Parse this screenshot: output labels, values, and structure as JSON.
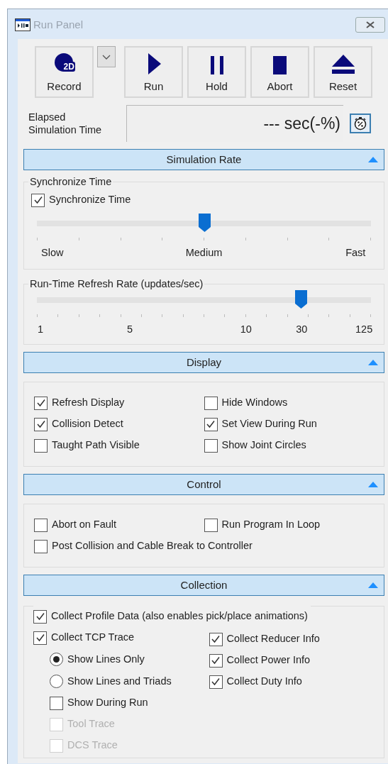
{
  "window": {
    "title": "Run Panel"
  },
  "toolbar": [
    {
      "kind": "record",
      "label": "Record",
      "badge": "2D"
    },
    {
      "kind": "dropdown"
    },
    {
      "kind": "run",
      "label": "Run"
    },
    {
      "kind": "hold",
      "label": "Hold"
    },
    {
      "kind": "abort",
      "label": "Abort"
    },
    {
      "kind": "reset",
      "label": "Reset"
    }
  ],
  "elapsed": {
    "label": "Elapsed Simulation Time",
    "value": "--- sec(-%)"
  },
  "sections": [
    {
      "kind": "rate",
      "title": "Simulation Rate",
      "expanded": true,
      "sync_group": {
        "title": "Synchronize Time",
        "checkbox": {
          "label": "Synchronize Time",
          "checked": true
        },
        "slider": {
          "level": 0.5,
          "labels": [
            "Slow",
            "Medium",
            "Fast"
          ]
        }
      },
      "refresh_group": {
        "title": "Run-Time Refresh Rate (updates/sec)",
        "slider": {
          "level": 0.79,
          "labels": [
            "1",
            "5",
            "10",
            "30",
            "125"
          ]
        }
      }
    },
    {
      "kind": "checks",
      "title": "Display",
      "expanded": true,
      "items": [
        {
          "label": "Refresh Display",
          "checked": true
        },
        {
          "label": "Hide Windows",
          "checked": false
        },
        {
          "label": "Collision Detect",
          "checked": true
        },
        {
          "label": "Set View During Run",
          "checked": true
        },
        {
          "label": "Taught Path Visible",
          "checked": false
        },
        {
          "label": "Show Joint Circles",
          "checked": false
        }
      ]
    },
    {
      "kind": "checks",
      "title": "Control",
      "expanded": true,
      "items": [
        {
          "label": "Abort on Fault",
          "checked": false
        },
        {
          "label": "Run Program In Loop",
          "checked": false
        },
        {
          "label": "Post Collision and Cable Break to Controller",
          "checked": false
        }
      ]
    },
    {
      "kind": "collection",
      "title": "Collection",
      "expanded": true,
      "top": {
        "label": "Collect Profile Data (also enables pick/place animations)",
        "checked": true
      },
      "left": [
        {
          "kind": "checkbox",
          "label": "Collect TCP Trace",
          "checked": true,
          "disabled": false,
          "children": [
            {
              "kind": "radio",
              "label": "Show Lines Only",
              "selected": true,
              "disabled": false
            },
            {
              "kind": "radio",
              "label": "Show Lines and Triads",
              "selected": false,
              "disabled": false
            },
            {
              "kind": "checkbox",
              "label": "Show During Run",
              "checked": false,
              "disabled": false
            },
            {
              "kind": "checkbox",
              "label": "Tool Trace",
              "checked": false,
              "disabled": true
            },
            {
              "kind": "checkbox",
              "label": "DCS Trace",
              "checked": false,
              "disabled": true
            }
          ]
        }
      ],
      "right": [
        {
          "kind": "checkbox",
          "label": "Collect Reducer Info",
          "checked": true,
          "disabled": false
        },
        {
          "kind": "checkbox",
          "label": "Collect Power Info",
          "checked": true,
          "disabled": false
        },
        {
          "kind": "checkbox",
          "label": "Collect Duty Info",
          "checked": true,
          "disabled": false
        }
      ]
    }
  ]
}
